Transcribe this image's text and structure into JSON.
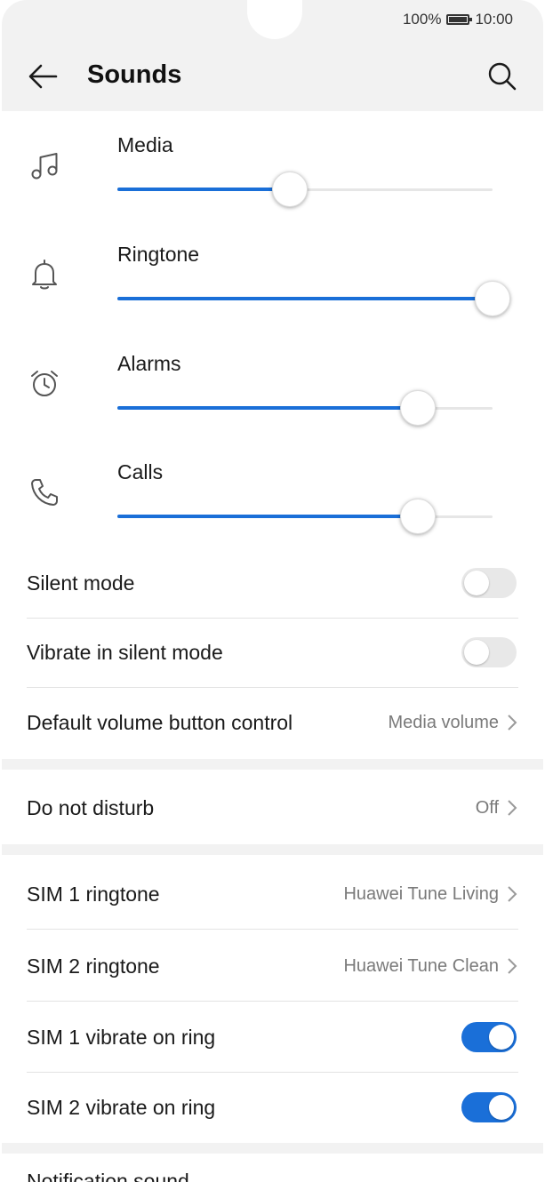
{
  "status_bar": {
    "battery_percent": "100%",
    "time": "10:00"
  },
  "header": {
    "title": "Sounds",
    "back_icon": "arrow-left-icon",
    "search_icon": "search-icon"
  },
  "volumes": [
    {
      "label": "Media",
      "icon": "music-note-icon",
      "level": 0.46
    },
    {
      "label": "Ringtone",
      "icon": "bell-icon",
      "level": 1.0
    },
    {
      "label": "Alarms",
      "icon": "alarm-clock-icon",
      "level": 0.8
    },
    {
      "label": "Calls",
      "icon": "phone-icon",
      "level": 0.8
    }
  ],
  "toggles_top": [
    {
      "label": "Silent mode",
      "on": false
    },
    {
      "label": "Vibrate in silent mode",
      "on": false
    }
  ],
  "default_volume": {
    "label": "Default volume button control",
    "value": "Media volume"
  },
  "do_not_disturb": {
    "label": "Do not disturb",
    "value": "Off"
  },
  "sim_ringtones": [
    {
      "label": "SIM 1 ringtone",
      "value": "Huawei Tune Living"
    },
    {
      "label": "SIM 2 ringtone",
      "value": "Huawei Tune Clean"
    }
  ],
  "sim_vibrate": [
    {
      "label": "SIM 1 vibrate on ring",
      "on": true
    },
    {
      "label": "SIM 2 vibrate on ring",
      "on": true
    }
  ],
  "cut_off_item": "Notification sound",
  "colors": {
    "accent": "#1a6fd8",
    "header_bg": "#f2f2f2",
    "secondary_text": "#7a7a7a"
  }
}
